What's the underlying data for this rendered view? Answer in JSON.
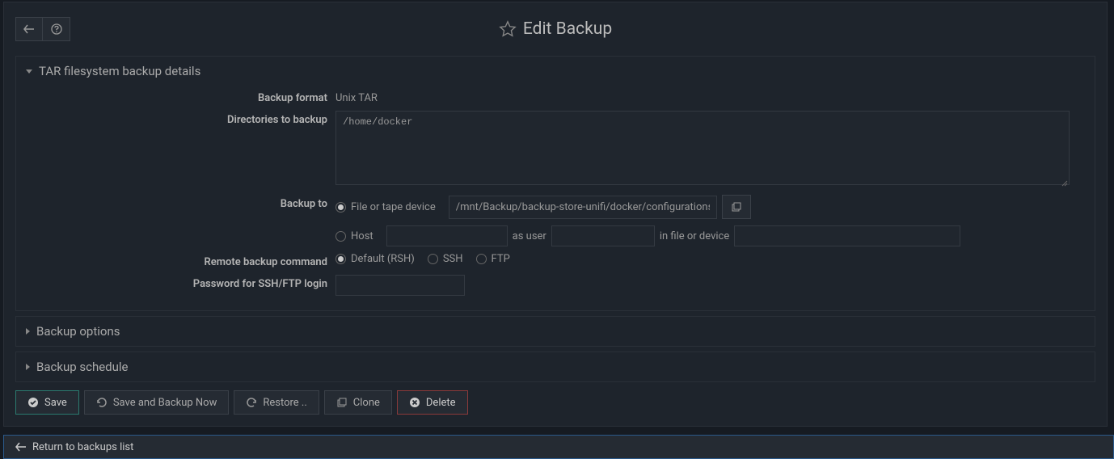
{
  "title": "Edit Backup",
  "sections": {
    "details": {
      "header": "TAR filesystem backup details",
      "backup_format_label": "Backup format",
      "backup_format_value": "Unix TAR",
      "dirs_label": "Directories to backup",
      "dirs_value": "/home/docker",
      "backup_to_label": "Backup to",
      "file_device_label": "File or tape device",
      "file_device_value": "/mnt/Backup/backup-store-unifi/docker/configurations",
      "host_label": "Host",
      "as_user_label": "as user",
      "in_file_label": "in file or device",
      "remote_cmd_label": "Remote backup command",
      "remote_default": "Default (RSH)",
      "remote_ssh": "SSH",
      "remote_ftp": "FTP",
      "password_label": "Password for SSH/FTP login"
    },
    "options": {
      "header": "Backup options"
    },
    "schedule": {
      "header": "Backup schedule"
    }
  },
  "actions": {
    "save": "Save",
    "save_backup": "Save and Backup Now",
    "restore": "Restore ..",
    "clone": "Clone",
    "delete": "Delete",
    "return": "Return to backups list"
  }
}
